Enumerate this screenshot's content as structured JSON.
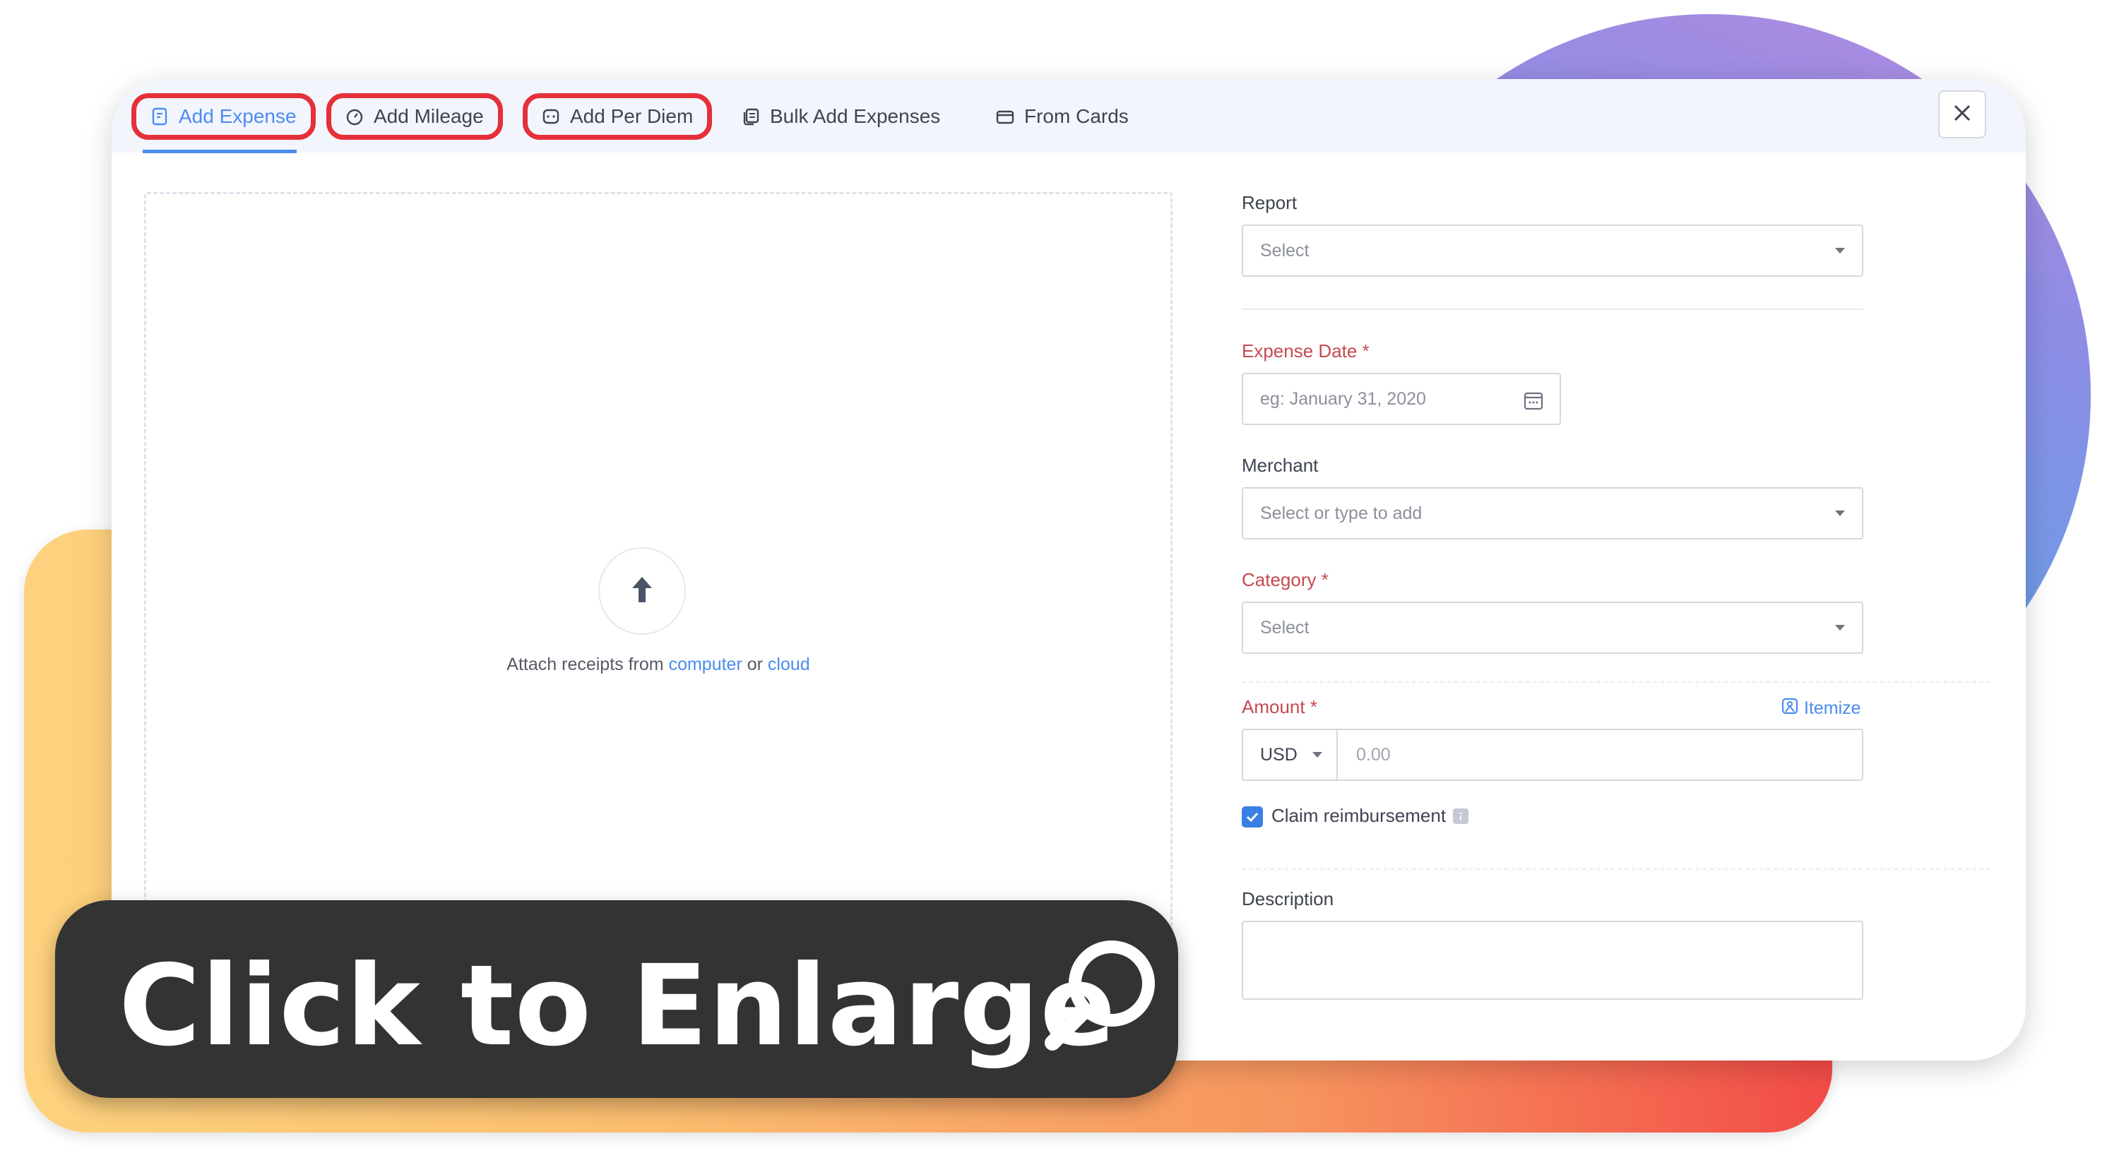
{
  "tabs": [
    {
      "label": "Add Expense",
      "icon": "receipt-icon",
      "active": true,
      "highlighted": true
    },
    {
      "label": "Add Mileage",
      "icon": "speedometer-icon",
      "active": false,
      "highlighted": true
    },
    {
      "label": "Add Per Diem",
      "icon": "per-diem-icon",
      "active": false,
      "highlighted": true
    },
    {
      "label": "Bulk Add Expenses",
      "icon": "bulk-copy-icon",
      "active": false,
      "highlighted": false
    },
    {
      "label": "From Cards",
      "icon": "card-icon",
      "active": false,
      "highlighted": false
    }
  ],
  "upload": {
    "prefix": "Attach receipts from",
    "computer_link": "computer",
    "or": "or",
    "cloud_link": "cloud"
  },
  "form": {
    "report": {
      "label": "Report",
      "placeholder": "Select"
    },
    "expense_date": {
      "label": "Expense Date *",
      "placeholder": "eg: January 31, 2020"
    },
    "merchant": {
      "label": "Merchant",
      "placeholder": "Select or type to add"
    },
    "category": {
      "label": "Category *",
      "placeholder": "Select"
    },
    "amount": {
      "label": "Amount *",
      "currency": "USD",
      "placeholder": "0.00",
      "itemize": "Itemize"
    },
    "claim_reimbursement": {
      "label": "Claim reimbursement",
      "checked": true
    },
    "description": {
      "label": "Description"
    }
  },
  "overlay": {
    "enlarge_text": "Click to Enlarge",
    "icon": "magnifier-icon"
  },
  "colors": {
    "accent": "#4a8cf0",
    "highlight": "#e53039",
    "required": "#c44a50",
    "overlay_bg": "#333333"
  }
}
